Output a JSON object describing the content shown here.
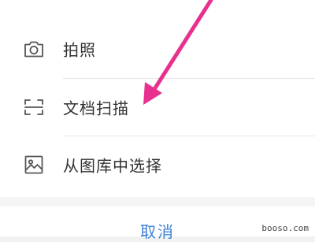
{
  "sheet": {
    "items": [
      {
        "label": "拍照",
        "icon": "camera-icon"
      },
      {
        "label": "文档扫描",
        "icon": "scan-icon"
      },
      {
        "label": "从图库中选择",
        "icon": "gallery-icon"
      }
    ],
    "cancel_label": "取消"
  },
  "annotation": {
    "arrow_color": "#e8318f"
  },
  "watermark": "booso.com",
  "colors": {
    "text": "#333333",
    "cancel": "#3b7fd6",
    "divider": "#e6e6e6"
  }
}
